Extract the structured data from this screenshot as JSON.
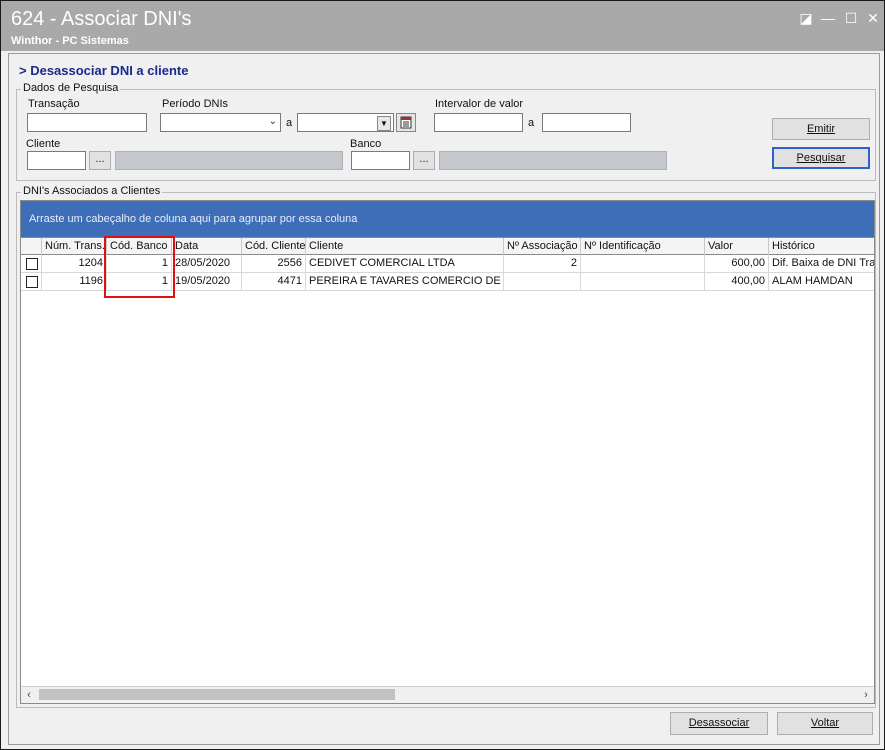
{
  "window": {
    "title": "624 - Associar DNI's",
    "subtitle": "Winthor - PC Sistemas",
    "controls": {
      "restore": "◪",
      "minimize": "—",
      "maximize": "☐",
      "close": "✕"
    }
  },
  "heading": "> Desassociar DNI a cliente",
  "search": {
    "group_label": "Dados de Pesquisa",
    "transacao_label": "Transação",
    "transacao_value": "",
    "periodo_label": "Período DNIs",
    "periodo_separator": "a",
    "periodo_from": "",
    "periodo_to": "",
    "valor_label": "Intervalor de valor",
    "valor_separator": "a",
    "valor_from": "",
    "valor_to": "",
    "cliente_label": "Cliente",
    "cliente_code": "",
    "cliente_lookup": "...",
    "banco_label": "Banco",
    "banco_code": "",
    "banco_lookup": "...",
    "emitir_label": "Emitir",
    "pesquisar_label": "Pesquisar"
  },
  "grid": {
    "group_label": "DNI's Associados a Clientes",
    "group_hint": "Arraste um cabeçalho de coluna aqui para agrupar por essa coluna",
    "columns": [
      "Núm. Trans.",
      "Cód. Banco",
      "Data",
      "Cód. Cliente",
      "Cliente",
      "Nº Associação",
      "Nº Identificação",
      "Valor",
      "Histórico"
    ],
    "rows": [
      {
        "num_trans": "1204",
        "cod_banco": "1",
        "data": "28/05/2020",
        "cod_cliente": "2556",
        "cliente": "CEDIVET COMERCIAL LTDA",
        "n_associacao": "2",
        "n_identificacao": "",
        "valor": "600,00",
        "historico": "Dif. Baixa de DNI Tran"
      },
      {
        "num_trans": "1196",
        "cod_banco": "1",
        "data": "19/05/2020",
        "cod_cliente": "4471",
        "cliente": "PEREIRA E TAVARES COMERCIO DE PRO",
        "n_associacao": "",
        "n_identificacao": "",
        "valor": "400,00",
        "historico": "ALAM HAMDAN"
      }
    ]
  },
  "footer": {
    "desassociar_label": "Desassociar",
    "voltar_label": "Voltar"
  },
  "colors": {
    "accent": "#3d6eb7",
    "highlight": "#e01010",
    "heading": "#1b2a8a"
  }
}
